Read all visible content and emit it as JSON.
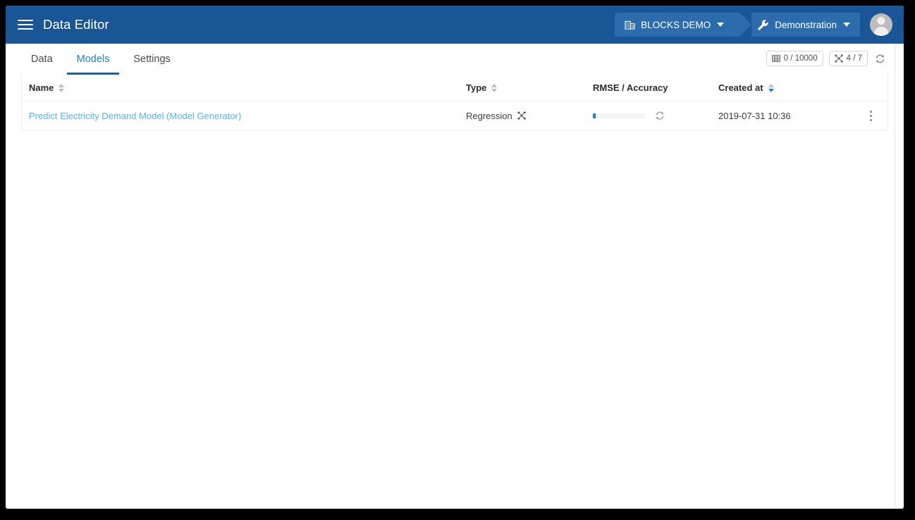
{
  "window": {
    "background_color": "#000000",
    "card_color": "#ffffff"
  },
  "appbar": {
    "background_color": "#1a5596",
    "menu_icon": "hamburger-menu-icon",
    "title": "Data Editor",
    "breadcrumb": {
      "project": {
        "icon": "building-icon",
        "label": "BLOCKS DEMO",
        "caret": "chevron-down-icon",
        "chip_color": "#2c6cac"
      },
      "environment": {
        "icon": "wrench-icon",
        "label": "Demonstration",
        "caret": "chevron-down-icon"
      }
    },
    "avatar": {
      "icon": "user-avatar-icon",
      "color": "#bdbdbd"
    }
  },
  "tabs": [
    {
      "label": "Data",
      "active": false
    },
    {
      "label": "Models",
      "active": true
    },
    {
      "label": "Settings",
      "active": false
    }
  ],
  "tab_accent_color": "#1c7fd6",
  "content_meta": {
    "rows_chip": {
      "icon": "table-grid-icon",
      "label": "0 / 10000"
    },
    "models_chip": {
      "icon": "model-nodes-icon",
      "label": "4 / 7"
    },
    "refresh": {
      "icon": "refresh-icon"
    }
  },
  "table": {
    "columns": [
      {
        "key": "name",
        "label": "Name",
        "sortable": true,
        "sort": "none"
      },
      {
        "key": "type",
        "label": "Type",
        "sortable": true,
        "sort": "none"
      },
      {
        "key": "rmse",
        "label": "RMSE / Accuracy",
        "sortable": false,
        "sort": "none"
      },
      {
        "key": "created",
        "label": "Created at",
        "sortable": true,
        "sort": "desc"
      }
    ],
    "rows": [
      {
        "name": "Predict Electricity Demand Model (Model Generator)",
        "name_color": "#51b4f2",
        "type": "Regression",
        "type_icon": "model-nodes-icon",
        "progress_percent": 4,
        "progress_color": "#1c7fd6",
        "progress_refresh_icon": "refresh-icon",
        "created": "2019-07-31 10:36",
        "menu_icon": "kebab-menu-icon"
      }
    ]
  }
}
